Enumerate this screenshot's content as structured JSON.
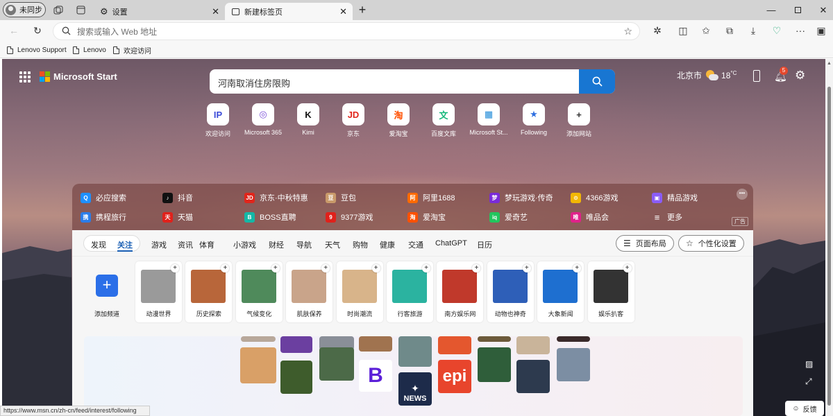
{
  "browser": {
    "profile_label": "未同步",
    "tabs": [
      {
        "label": "设置",
        "active": false
      },
      {
        "label": "新建标签页",
        "active": true
      }
    ],
    "address_placeholder": "搜索或输入 Web 地址",
    "favorites": [
      "Lenovo Support",
      "Lenovo",
      "欢迎访问"
    ],
    "status_url": "https://www.msn.cn/zh-cn/feed/interest/following"
  },
  "header": {
    "brand": "Microsoft Start",
    "search_text": "河南取消住房限购",
    "city": "北京市",
    "temperature": "18",
    "temp_unit": "°C",
    "notification_count": "5"
  },
  "quicklinks": [
    {
      "label": "欢迎访问",
      "glyph": "IP",
      "color": "#3b4bd8"
    },
    {
      "label": "Microsoft 365",
      "glyph": "◎",
      "color": "#7b4fd8"
    },
    {
      "label": "Kimi",
      "glyph": "K",
      "color": "#111111"
    },
    {
      "label": "京东",
      "glyph": "JD",
      "color": "#e1251b"
    },
    {
      "label": "爱淘宝",
      "glyph": "淘",
      "color": "#ff5000"
    },
    {
      "label": "百度文库",
      "glyph": "文",
      "color": "#14b87a"
    },
    {
      "label": "Microsoft St...",
      "glyph": "▦",
      "color": "#1f8ad8"
    },
    {
      "label": "Following",
      "glyph": "★",
      "color": "#2f6fe0"
    },
    {
      "label": "添加网站",
      "glyph": "+",
      "color": "#333333"
    }
  ],
  "links": {
    "row1": [
      {
        "label": "必应搜索",
        "glyph": "Q",
        "color": "#1e90ff"
      },
      {
        "label": "抖音",
        "glyph": "♪",
        "color": "#111111"
      },
      {
        "label": "京东·中秋特惠",
        "glyph": "JD",
        "color": "#e1251b"
      },
      {
        "label": "豆包",
        "glyph": "豆",
        "color": "#c99a6a"
      },
      {
        "label": "阿里1688",
        "glyph": "阿",
        "color": "#ff6a00"
      },
      {
        "label": "梦玩游戏·传奇",
        "glyph": "梦",
        "color": "#7a2bd8"
      },
      {
        "label": "4366游戏",
        "glyph": "⊙",
        "color": "#f2b705"
      },
      {
        "label": "精品游戏",
        "glyph": "▣",
        "color": "#8a5cf6"
      }
    ],
    "row2": [
      {
        "label": "携程旅行",
        "glyph": "携",
        "color": "#2b7de9"
      },
      {
        "label": "天猫",
        "glyph": "天",
        "color": "#e0211b"
      },
      {
        "label": "BOSS直聘",
        "glyph": "B",
        "color": "#14b8a6"
      },
      {
        "label": "9377游戏",
        "glyph": "9",
        "color": "#e0211b"
      },
      {
        "label": "爱淘宝",
        "glyph": "淘",
        "color": "#ff5000"
      },
      {
        "label": "爱奇艺",
        "glyph": "iq",
        "color": "#22c55e"
      },
      {
        "label": "唯品会",
        "glyph": "唯",
        "color": "#e0218a"
      },
      {
        "label": "更多",
        "glyph": "≡",
        "color": "transparent"
      }
    ],
    "ad_label": "广告"
  },
  "feed_nav": {
    "toggle": [
      "发现",
      "关注"
    ],
    "items": [
      "游戏",
      "资讯",
      "体育",
      "小游戏",
      "财经",
      "导航",
      "天气",
      "购物",
      "健康",
      "交通",
      "ChatGPT",
      "日历"
    ],
    "layout_button": "页面布局",
    "personalize_button": "个性化设置"
  },
  "channels": {
    "add_label": "添加频道",
    "cards": [
      {
        "label": "动漫世界",
        "color": "#9a9a9a"
      },
      {
        "label": "历史探索",
        "color": "#b8663a"
      },
      {
        "label": "气候变化",
        "color": "#4f8a5b"
      },
      {
        "label": "肌肤保养",
        "color": "#c9a48a"
      },
      {
        "label": "时尚潮流",
        "color": "#d8b48a"
      },
      {
        "label": "行客旅游",
        "color": "#2bb3a0"
      },
      {
        "label": "南方娱乐网",
        "color": "#c0392b"
      },
      {
        "label": "动物也神奇",
        "color": "#2e5fb8"
      },
      {
        "label": "大象新闻",
        "color": "#1e6fd0"
      },
      {
        "label": "娱乐扒客",
        "color": "#333333"
      }
    ]
  },
  "promo_tiles": {
    "b_logo": "B",
    "news_logo": "NEWS",
    "epi_logo": "epi"
  },
  "feedback_label": "反馈",
  "colors": {
    "accent": "#1876d2",
    "badge": "#e5482d"
  }
}
